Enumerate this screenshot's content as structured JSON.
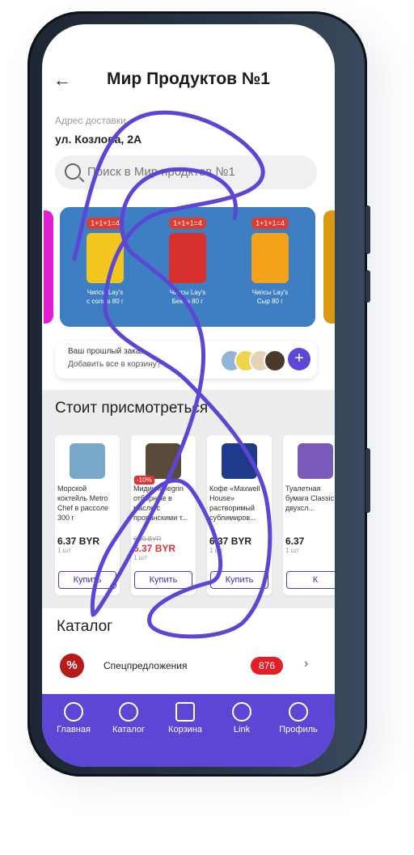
{
  "header": {
    "back_icon": "←",
    "title": "Мир Продуктов №1"
  },
  "address": {
    "label": "Адрес доставки",
    "value": "ул. Козлова, 2А"
  },
  "search": {
    "placeholder": "Поиск в Мир продктов №1"
  },
  "promo": {
    "items": [
      {
        "badge": "1+1+1=4",
        "name_line1": "Чипсы Lay's",
        "name_line2": "с солью 80 г",
        "color": "#f2c51f"
      },
      {
        "badge": "1+1+1=4",
        "name_line1": "Чипсы Lay's",
        "name_line2": "Бекон 80 г",
        "color": "#d8302d"
      },
      {
        "badge": "1+1+1=4",
        "name_line1": "Чипсы Lay's",
        "name_line2": "Сыр 80 г",
        "color": "#f3a21a"
      }
    ]
  },
  "last_order": {
    "title": "Ваш прошлый заказ",
    "subtitle": "Добавить все в корзину?",
    "plus": "+"
  },
  "watch": {
    "title": "Стоит присмотреться",
    "products": [
      {
        "name": "Морской коктейль Metro Chef в рассоле 300 г",
        "old_price": "",
        "price": "6.37 BYR",
        "unit": "1 шт",
        "buy": "Купить",
        "discount": "",
        "color": "#7aa8c8"
      },
      {
        "name": "Мидии Milegrin отборные в масле с прованскими т...",
        "old_price": "6.99 BYR",
        "price": "6.37 BYR",
        "unit": "1 шт",
        "buy": "Купить",
        "discount": "-10%",
        "color": "#5a4a3a"
      },
      {
        "name": "Кофе «Maxwell House» растворимый сублимиров...",
        "old_price": "",
        "price": "6.37 BYR",
        "unit": "1 шт",
        "buy": "Купить",
        "discount": "",
        "color": "#1d3b8a"
      },
      {
        "name": "Туалетная бумага Classic двухсл...",
        "old_price": "",
        "price": "6.37",
        "unit": "1 шт",
        "buy": "К",
        "discount": "",
        "color": "#7a5ab8"
      }
    ]
  },
  "catalog": {
    "title": "Каталог",
    "special_icon": "%",
    "special_label": "Спецпредложения",
    "special_count": "876",
    "chevron": "›"
  },
  "nav": {
    "items": [
      {
        "label": "Главная",
        "icon": "home-icon"
      },
      {
        "label": "Каталог",
        "icon": "search-icon"
      },
      {
        "label": "Корзина",
        "icon": "cart-icon"
      },
      {
        "label": "Link",
        "icon": "location-icon"
      },
      {
        "label": "Профиль",
        "icon": "profile-icon"
      }
    ]
  },
  "colors": {
    "accent": "#5b46d6",
    "promo_bg": "#3e7fc3",
    "sale": "#e03232",
    "badge": "#e31e24"
  }
}
